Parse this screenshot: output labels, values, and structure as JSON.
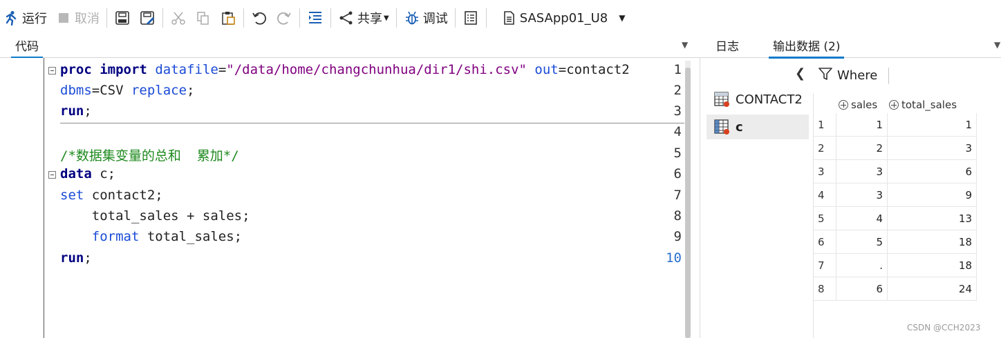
{
  "toolbar": {
    "run_label": "运行",
    "cancel_label": "取消",
    "share_label": "共享",
    "debug_label": "调试",
    "server_label": "SASApp01_U8"
  },
  "tabs": {
    "code": "代码",
    "log": "日志",
    "output": "输出数据 (2)"
  },
  "editor": {
    "line_numbers": [
      "1",
      "2",
      "3",
      "4",
      "5",
      "6",
      "7",
      "8",
      "9",
      "10"
    ],
    "lines": {
      "l1_kw1": "proc",
      "l1_kw2": "import",
      "l1_opt": "datafile",
      "l1_eq": "=",
      "l1_str": "\"/data/home/changchunhua/dir1/shi.csv\"",
      "l1_opt2": "out",
      "l1_rest": "=contact2",
      "l2_a": "dbms",
      "l2_b": "=CSV ",
      "l2_c": "replace",
      "l2_d": ";",
      "l3_kw": "run",
      "l3_end": ";",
      "l5_comment": "/*数据集变量的总和  累加*/",
      "l6_kw": "data",
      "l6_rest": " c;",
      "l7_kw": "set",
      "l7_rest": " contact2;",
      "l8_rest": "    total_sales + sales;",
      "l9_kw": "format",
      "l9_rest": " total_sales;",
      "l10_kw": "run",
      "l10_end": ";"
    }
  },
  "right_pane": {
    "where_label": "Where",
    "datasets": [
      "CONTACT2",
      "c"
    ],
    "columns": [
      "sales",
      "total_sales"
    ],
    "rows": [
      {
        "idx": "1",
        "sales": "1",
        "total_sales": "1"
      },
      {
        "idx": "2",
        "sales": "2",
        "total_sales": "3"
      },
      {
        "idx": "3",
        "sales": "3",
        "total_sales": "6"
      },
      {
        "idx": "4",
        "sales": "3",
        "total_sales": "9"
      },
      {
        "idx": "5",
        "sales": "4",
        "total_sales": "13"
      },
      {
        "idx": "6",
        "sales": "5",
        "total_sales": "18"
      },
      {
        "idx": "7",
        "sales": ".",
        "total_sales": "18"
      },
      {
        "idx": "8",
        "sales": "6",
        "total_sales": "24"
      }
    ]
  },
  "watermark": "CSDN @CCH2023",
  "colors": {
    "accent": "#0a7bcb",
    "keyword": "#000080",
    "option": "#1a4bd6",
    "string": "#800080",
    "comment": "#1f8a1f"
  }
}
